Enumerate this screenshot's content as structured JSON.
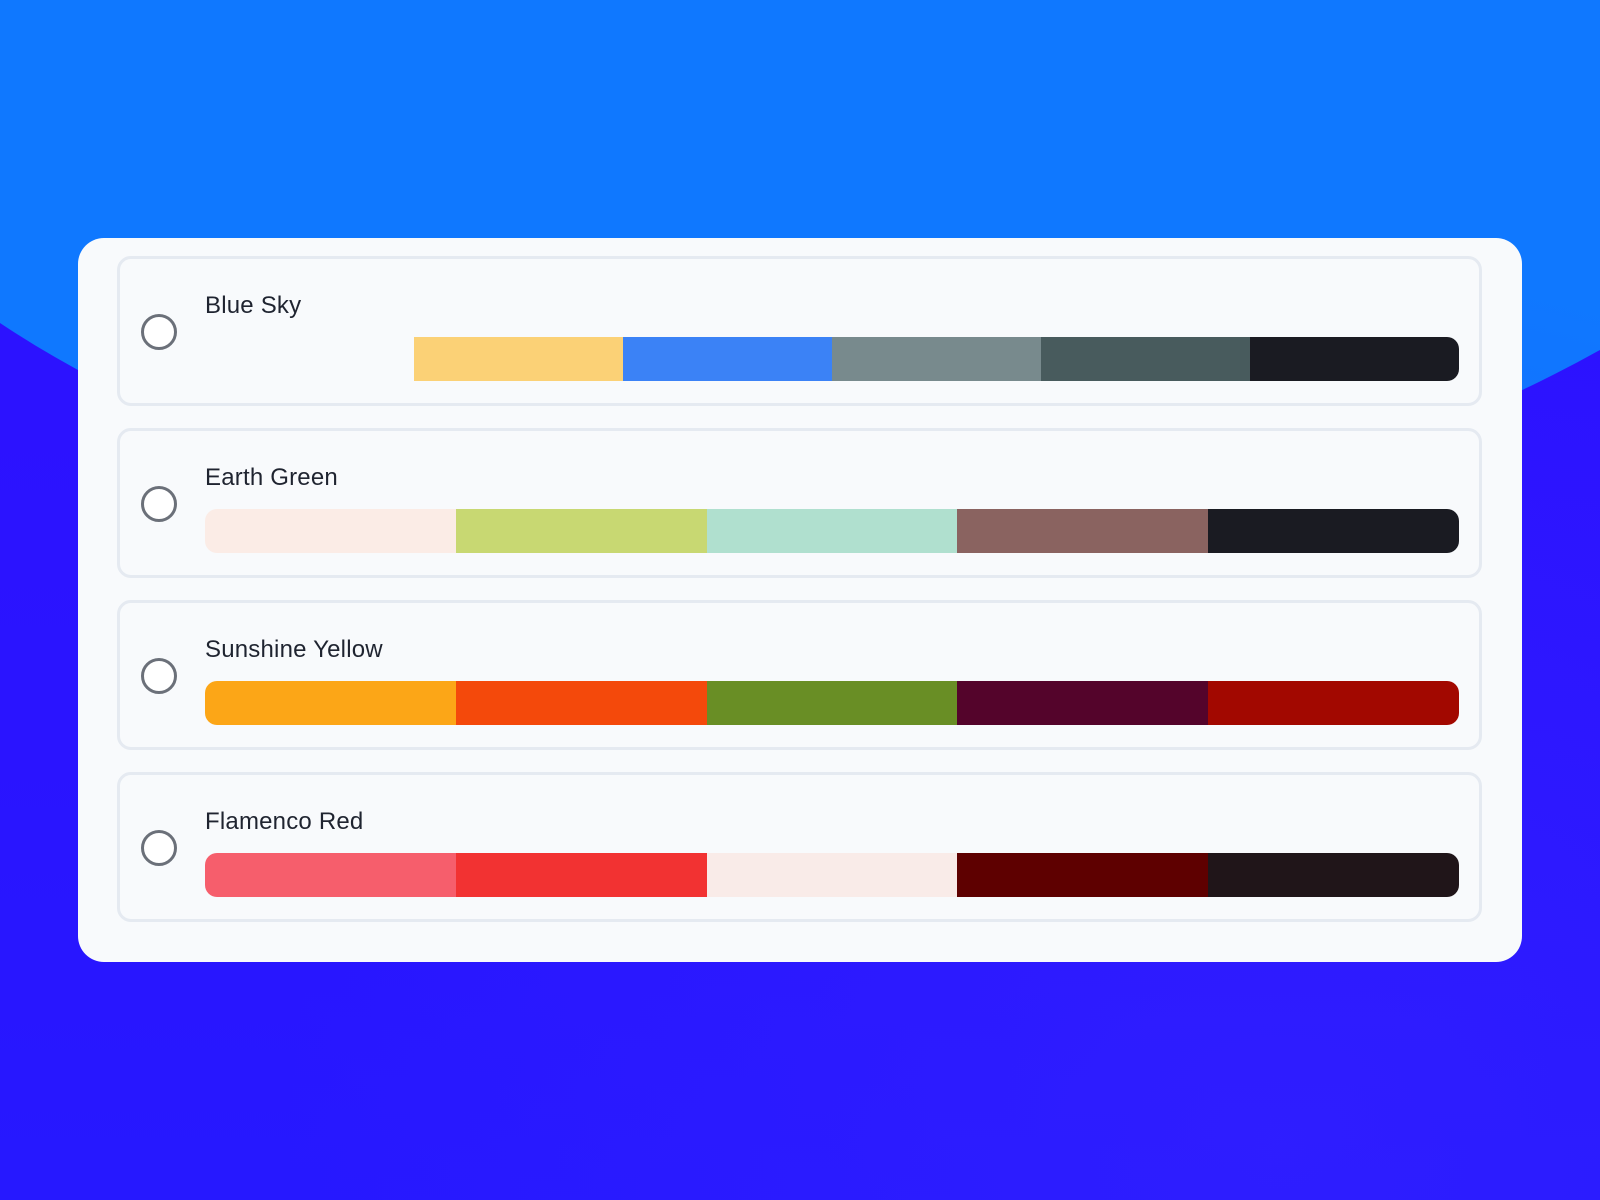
{
  "palettes": [
    {
      "name": "Blue Sky",
      "colors": [
        "#f8fafc",
        "#fbd176",
        "#3b82f6",
        "#788a8d",
        "#485b5d",
        "#1a1b22"
      ]
    },
    {
      "name": "Earth Green",
      "colors": [
        "#fbece6",
        "#c8d872",
        "#b0e0cf",
        "#8a6360",
        "#1a1b22"
      ]
    },
    {
      "name": "Sunshine Yellow",
      "colors": [
        "#fca617",
        "#f4490b",
        "#698e25",
        "#54042b",
        "#a20800"
      ]
    },
    {
      "name": "Flamenco Red",
      "colors": [
        "#f65e6c",
        "#f23232",
        "#f9ebe8",
        "#5e0000",
        "#201519"
      ]
    }
  ],
  "icons": {
    "radio": "radio-unchecked-icon"
  }
}
